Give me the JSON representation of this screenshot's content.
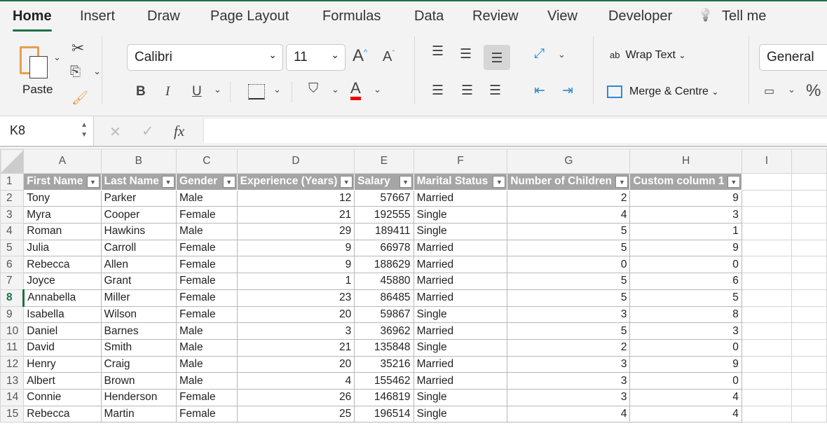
{
  "tabs": [
    "Home",
    "Insert",
    "Draw",
    "Page Layout",
    "Formulas",
    "Data",
    "Review",
    "View",
    "Developer",
    "Tell me"
  ],
  "ribbon": {
    "paste": "Paste",
    "font": "Calibri",
    "size": "11",
    "bold": "B",
    "italic": "I",
    "underline": "U",
    "font_color_glyph": "A",
    "grow": "A",
    "shrink": "A",
    "wrap_text": "Wrap Text",
    "merge": "Merge & Centre",
    "number_format": "General",
    "percent": "%",
    "fill_color": "#ff0000",
    "wrap_icon_text": "ab"
  },
  "formula_bar": {
    "name_box": "K8",
    "fx": "fx",
    "cancel": "✕",
    "enter": "✓",
    "value": ""
  },
  "columns": [
    "A",
    "B",
    "C",
    "D",
    "E",
    "F",
    "G",
    "H",
    "I"
  ],
  "headers": [
    "First Name",
    "Last Name",
    "Gender",
    "Experience (Years)",
    "Salary",
    "Marital Status",
    "Number of Children",
    "Custom column 1"
  ],
  "rows": [
    [
      "Tony",
      "Parker",
      "Male",
      "12",
      "57667",
      "Married",
      "2",
      "9"
    ],
    [
      "Myra",
      "Cooper",
      "Female",
      "21",
      "192555",
      "Single",
      "4",
      "3"
    ],
    [
      "Roman",
      "Hawkins",
      "Male",
      "29",
      "189411",
      "Single",
      "5",
      "1"
    ],
    [
      "Julia",
      "Carroll",
      "Female",
      "9",
      "66978",
      "Married",
      "5",
      "9"
    ],
    [
      "Rebecca",
      "Allen",
      "Female",
      "9",
      "188629",
      "Married",
      "0",
      "0"
    ],
    [
      "Joyce",
      "Grant",
      "Female",
      "1",
      "45880",
      "Married",
      "5",
      "6"
    ],
    [
      "Annabella",
      "Miller",
      "Female",
      "23",
      "86485",
      "Married",
      "5",
      "5"
    ],
    [
      "Isabella",
      "Wilson",
      "Female",
      "20",
      "59867",
      "Single",
      "3",
      "8"
    ],
    [
      "Daniel",
      "Barnes",
      "Male",
      "3",
      "36962",
      "Married",
      "5",
      "3"
    ],
    [
      "David",
      "Smith",
      "Male",
      "21",
      "135848",
      "Single",
      "2",
      "0"
    ],
    [
      "Henry",
      "Craig",
      "Male",
      "20",
      "35216",
      "Married",
      "3",
      "9"
    ],
    [
      "Albert",
      "Brown",
      "Male",
      "4",
      "155462",
      "Married",
      "3",
      "0"
    ],
    [
      "Connie",
      "Henderson",
      "Female",
      "26",
      "146819",
      "Single",
      "3",
      "4"
    ],
    [
      "Rebecca",
      "Martin",
      "Female",
      "25",
      "196514",
      "Single",
      "4",
      "4"
    ]
  ],
  "selected_row": 8
}
